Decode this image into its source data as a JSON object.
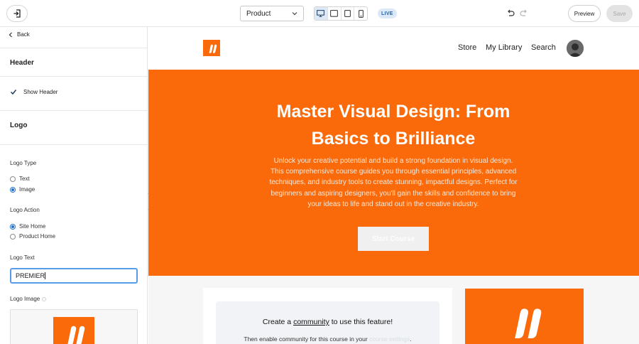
{
  "toolbar": {
    "page_select_value": "Product",
    "live_label": "LIVE",
    "preview_label": "Preview",
    "save_label": "Save"
  },
  "sidebar": {
    "back_label": "Back",
    "header_section": "Header",
    "show_header_label": "Show Header",
    "logo_section": "Logo",
    "logo_type_label": "Logo Type",
    "logo_type_options": [
      "Text",
      "Image"
    ],
    "logo_type_selected": "Image",
    "logo_action_label": "Logo Action",
    "logo_action_options": [
      "Site Home",
      "Product Home"
    ],
    "logo_action_selected": "Site Home",
    "logo_text_label": "Logo Text",
    "logo_text_value": "PREMIER",
    "logo_image_label": "Logo Image"
  },
  "site": {
    "nav": [
      "Store",
      "My Library",
      "Search"
    ],
    "hero_title": "Master Visual Design: From Basics to Brilliance",
    "hero_description": "Unlock your creative potential and build a strong foundation in visual design. This comprehensive course guides you through essential principles, advanced techniques, and industry tools to create stunning, impactful designs. Perfect for beginners and aspiring designers, you'll gain the skills and confidence to bring your ideas to life and stand out in the creative industry.",
    "start_button": "Start Course",
    "community_prefix": "Create a ",
    "community_link": "community",
    "community_suffix": " to use this feature!",
    "community_sub_prefix": "Then enable community for this course in your ",
    "community_sub_link": "course settings",
    "community_sub_suffix": "."
  },
  "colors": {
    "brand_orange": "#fa6a0a",
    "accent_blue": "#1f6fd1"
  }
}
